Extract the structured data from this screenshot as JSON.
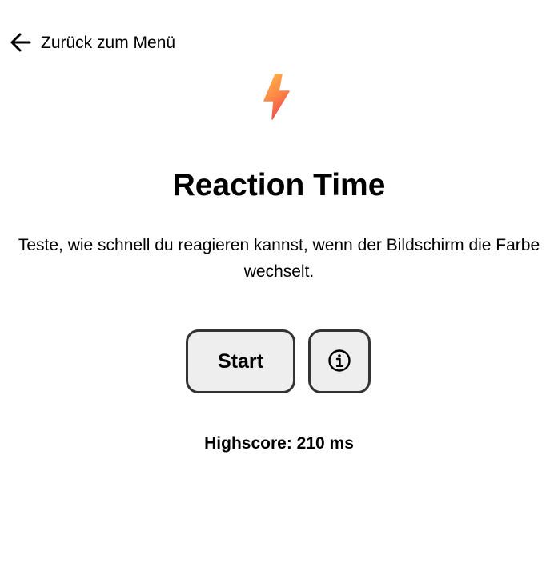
{
  "nav": {
    "back_label": "Zurück zum Menü",
    "back_icon": "arrow-left-icon"
  },
  "header": {
    "logo_icon": "lightning-bolt-icon",
    "logo_colors": [
      "#FFB347",
      "#FF7F50",
      "#F0504A"
    ],
    "title": "Reaction Time",
    "description": "Teste, wie schnell du reagieren kannst, wenn der Bildschirm die Farbe wechselt."
  },
  "actions": {
    "start_label": "Start",
    "info_icon": "info-circle-icon"
  },
  "stats": {
    "highscore_text": "Highscore: 210 ms"
  },
  "colors": {
    "button_bg": "#EEEEEE",
    "button_border": "#333333",
    "text": "#000000",
    "background": "#FFFFFF"
  }
}
